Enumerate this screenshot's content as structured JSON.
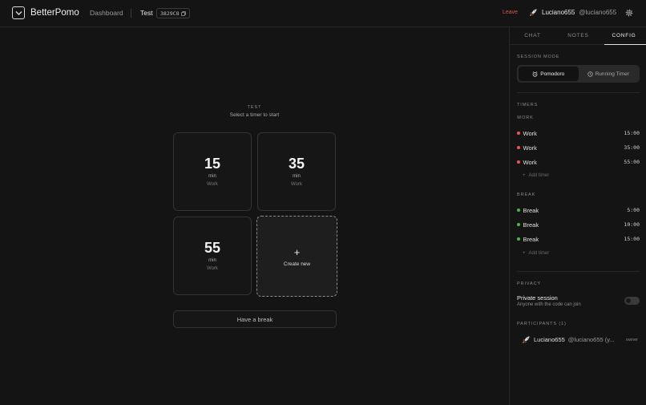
{
  "app": {
    "brand": "BetterPomo",
    "nav_dashboard": "Dashboard",
    "session_name": "Test",
    "session_code": "3829C8",
    "leave": "Leave",
    "user_name": "Luciano655",
    "user_handle": "@luciano655"
  },
  "main": {
    "title": "TEST",
    "subtitle": "Select a timer to start",
    "timers": [
      {
        "value": "15",
        "unit": "min",
        "kind": "Work"
      },
      {
        "value": "35",
        "unit": "min",
        "kind": "Work"
      },
      {
        "value": "55",
        "unit": "min",
        "kind": "Work"
      }
    ],
    "create_label": "Create new",
    "create_symbol": "+",
    "break_button": "Have a break"
  },
  "sidebar": {
    "tabs": [
      "CHAT",
      "NOTES",
      "CONFIG"
    ],
    "active_tab": "CONFIG",
    "session_mode_label": "SESSION MODE",
    "modes": [
      "Pomodoro",
      "Running Timer"
    ],
    "active_mode": "Pomodoro",
    "timers_label": "TIMERS",
    "work_label": "WORK",
    "work_timers": [
      {
        "name": "Work",
        "time": "15:00"
      },
      {
        "name": "Work",
        "time": "35:00"
      },
      {
        "name": "Work",
        "time": "55:00"
      }
    ],
    "break_label": "BREAK",
    "break_timers": [
      {
        "name": "Break",
        "time": "5:00"
      },
      {
        "name": "Break",
        "time": "10:00"
      },
      {
        "name": "Break",
        "time": "15:00"
      }
    ],
    "add_timer": "Add timer",
    "privacy_label": "PRIVACY",
    "private_title": "Private session",
    "private_sub": "Anyone with the code can join",
    "private_enabled": false,
    "participants_label": "PARTICIPANTS (1)",
    "participant_name": "Luciano655",
    "participant_handle": "@luciano655 (y...",
    "participant_role": "owner"
  },
  "colors": {
    "work_dot": "#e05555",
    "break_dot": "#4caf50",
    "leave": "#d9534f"
  }
}
